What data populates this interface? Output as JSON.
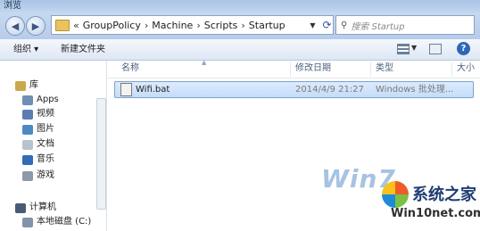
{
  "window": {
    "title": "浏览"
  },
  "nav": {
    "breadcrumb": [
      "GroupPolicy",
      "Machine",
      "Scripts",
      "Startup"
    ],
    "overflow": "«",
    "search_placeholder": "搜索 Startup"
  },
  "toolbar": {
    "organize": "组织 ▾",
    "new_folder": "新建文件夹"
  },
  "sidebar": {
    "items": [
      {
        "label": "库",
        "color": "#c9a94a"
      },
      {
        "label": "Apps",
        "color": "#6f8fb7"
      },
      {
        "label": "视频",
        "color": "#5b7db1"
      },
      {
        "label": "图片",
        "color": "#4d8ac4"
      },
      {
        "label": "文档",
        "color": "#b9c3cf"
      },
      {
        "label": "音乐",
        "color": "#2f6db8"
      },
      {
        "label": "游戏",
        "color": "#8c9aa8"
      },
      {
        "label": "计算机",
        "color": "#4a5b73"
      },
      {
        "label": "本地磁盘 (C:)",
        "color": "#8293aa"
      }
    ]
  },
  "table": {
    "columns": [
      "名称",
      "修改日期",
      "类型",
      "大小"
    ],
    "rows": [
      {
        "name": "Wifi.bat",
        "modified": "2014/4/9 21:27",
        "type": "Windows 批处理..."
      }
    ]
  },
  "watermark": {
    "brand": "Win7",
    "name": "系统之家",
    "site": "Win10net.com"
  }
}
